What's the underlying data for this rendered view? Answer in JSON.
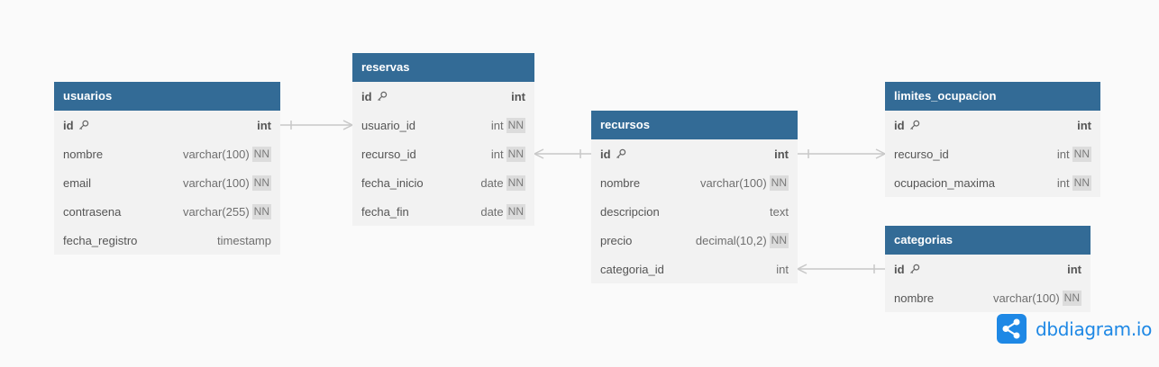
{
  "tables": [
    {
      "name": "usuarios",
      "fields": [
        {
          "name": "id",
          "type": "int",
          "pk": true,
          "nn": false
        },
        {
          "name": "nombre",
          "type": "varchar(100)",
          "pk": false,
          "nn": true
        },
        {
          "name": "email",
          "type": "varchar(100)",
          "pk": false,
          "nn": true
        },
        {
          "name": "contrasena",
          "type": "varchar(255)",
          "pk": false,
          "nn": true
        },
        {
          "name": "fecha_registro",
          "type": "timestamp",
          "pk": false,
          "nn": false
        }
      ]
    },
    {
      "name": "reservas",
      "fields": [
        {
          "name": "id",
          "type": "int",
          "pk": true,
          "nn": false
        },
        {
          "name": "usuario_id",
          "type": "int",
          "pk": false,
          "nn": true
        },
        {
          "name": "recurso_id",
          "type": "int",
          "pk": false,
          "nn": true
        },
        {
          "name": "fecha_inicio",
          "type": "date",
          "pk": false,
          "nn": true
        },
        {
          "name": "fecha_fin",
          "type": "date",
          "pk": false,
          "nn": true
        }
      ]
    },
    {
      "name": "recursos",
      "fields": [
        {
          "name": "id",
          "type": "int",
          "pk": true,
          "nn": false
        },
        {
          "name": "nombre",
          "type": "varchar(100)",
          "pk": false,
          "nn": true
        },
        {
          "name": "descripcion",
          "type": "text",
          "pk": false,
          "nn": false
        },
        {
          "name": "precio",
          "type": "decimal(10,2)",
          "pk": false,
          "nn": true
        },
        {
          "name": "categoria_id",
          "type": "int",
          "pk": false,
          "nn": false
        }
      ]
    },
    {
      "name": "limites_ocupacion",
      "fields": [
        {
          "name": "id",
          "type": "int",
          "pk": true,
          "nn": false
        },
        {
          "name": "recurso_id",
          "type": "int",
          "pk": false,
          "nn": true
        },
        {
          "name": "ocupacion_maxima",
          "type": "int",
          "pk": false,
          "nn": true
        }
      ]
    },
    {
      "name": "categorias",
      "fields": [
        {
          "name": "id",
          "type": "int",
          "pk": true,
          "nn": false
        },
        {
          "name": "nombre",
          "type": "varchar(100)",
          "pk": false,
          "nn": true
        }
      ]
    }
  ],
  "relations": [
    {
      "from": "reservas.usuario_id",
      "to": "usuarios.id"
    },
    {
      "from": "reservas.recurso_id",
      "to": "recursos.id"
    },
    {
      "from": "limites_ocupacion.recurso_id",
      "to": "recursos.id"
    },
    {
      "from": "recursos.categoria_id",
      "to": "categorias.id"
    }
  ],
  "nn_label": "NN",
  "brand": {
    "name": "dbdiagram.io"
  },
  "colors": {
    "header": "#336b96",
    "body": "#f2f2f2",
    "connector": "#c8c8c8",
    "brand": "#1e88e5"
  },
  "icons": {
    "primary_key": "key-icon",
    "logo": "share-icon"
  }
}
